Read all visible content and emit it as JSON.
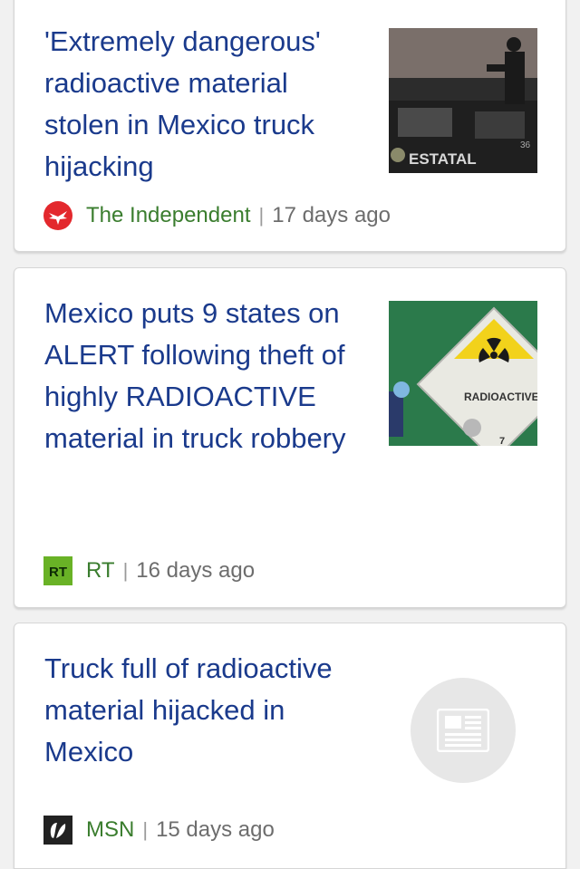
{
  "articles": [
    {
      "headline": "'Extremely dangerous' radioactive material stolen in Mexico truck hijacking",
      "source": "The Independent",
      "separator": "|",
      "age": "17 days ago",
      "source_icon": "independent-eagle-icon",
      "thumbnail_text": "ESTATAL",
      "thumbnail_number": "36"
    },
    {
      "headline": "Mexico puts 9 states on ALERT following theft of highly RADIOACTIVE material in truck robbery",
      "source": "RT",
      "separator": "|",
      "age": "16 days ago",
      "source_icon": "rt-logo-icon",
      "source_icon_text": "RT",
      "thumbnail_text": "RADIOACTIVE",
      "thumbnail_number": "7"
    },
    {
      "headline": "Truck full of radioactive material hijacked in Mexico",
      "source": "MSN",
      "separator": "|",
      "age": "15 days ago",
      "source_icon": "msn-butterfly-icon",
      "thumbnail_icon": "newspaper-icon"
    }
  ],
  "colors": {
    "headline": "#1a3a8c",
    "source": "#3a7d2e",
    "age": "#6d6d6d",
    "background": "#f1f1f1"
  }
}
